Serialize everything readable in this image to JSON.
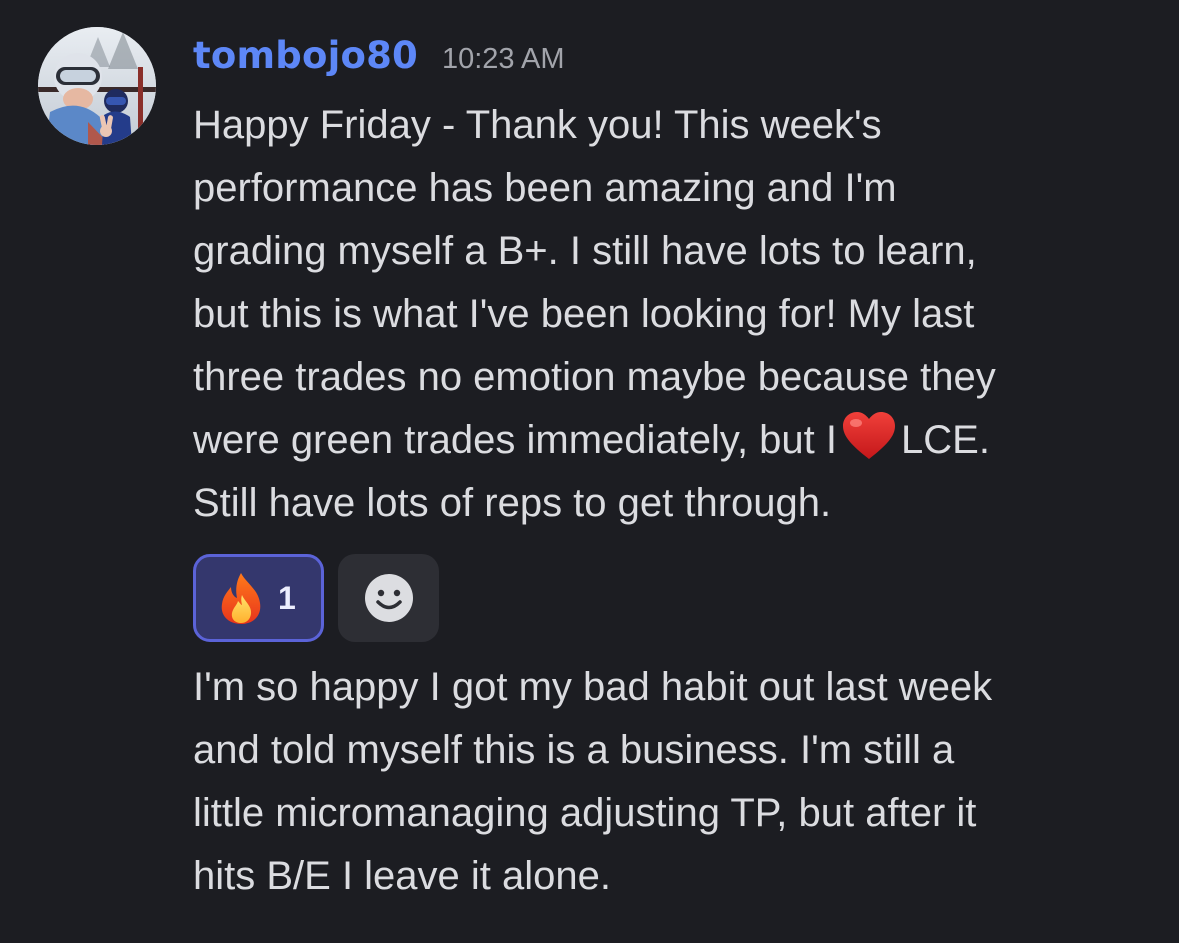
{
  "message": {
    "username": "tombojo80",
    "timestamp": "10:23 AM",
    "avatar_icon": "user-avatar-photo",
    "first_text_lines": [
      "Happy Friday - Thank you! This week's",
      "performance has been amazing and I'm",
      "grading myself a B+. I still have lots to learn,",
      "but this is what I've been looking for! My last",
      "three trades no emotion maybe because they"
    ],
    "line6_before_emoji": "were green trades immediately, but I",
    "line6_emoji": "red-heart-emoji",
    "line6_after_emoji": "LCE.",
    "line7": "Still have lots of reps to get through.",
    "second_text_lines": [
      "I'm so happy I got my bad habit out last week",
      "and told myself this is a business. I'm still a",
      "little micromanaging adjusting TP, but after it",
      "hits B/E I leave it alone."
    ]
  },
  "reactions": [
    {
      "emoji": "fire-emoji",
      "count": "1",
      "active": true
    }
  ],
  "add_reaction_icon": "smiley-add-reaction-icon",
  "colors": {
    "background": "#1c1d22",
    "username": "#5d87f7",
    "timestamp": "#a2a4ab",
    "text": "#dbdce0",
    "reaction_border": "#5b63d8",
    "reaction_bg": "#34376d",
    "add_reaction_bg": "#2d2e34"
  }
}
